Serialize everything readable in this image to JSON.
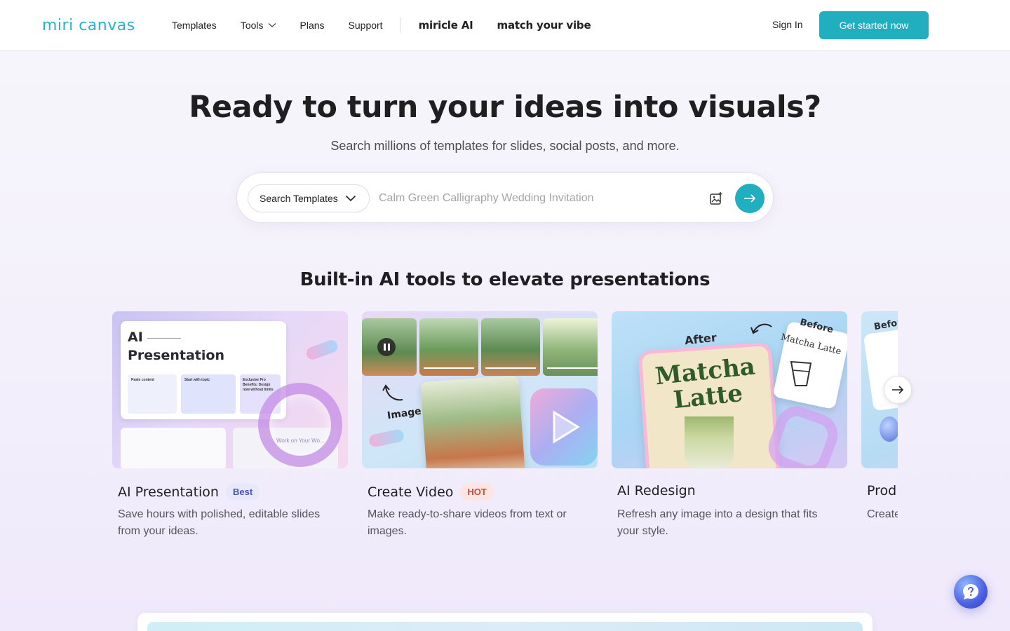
{
  "header": {
    "logo_text": "miri canvas",
    "nav": [
      {
        "label": "Templates"
      },
      {
        "label": "Tools"
      },
      {
        "label": "Plans"
      },
      {
        "label": "Support"
      }
    ],
    "brand_links": [
      "miricle AI",
      "match your vibe"
    ],
    "sign_in": "Sign In",
    "cta": "Get started now"
  },
  "hero": {
    "title": "Ready to turn your ideas into visuals?",
    "subtitle": "Search millions of templates for slides, social posts, and more.",
    "search": {
      "select_label": "Search Templates",
      "placeholder": "Calm Green Calligraphy Wedding Invitation",
      "value": ""
    }
  },
  "tools_section": {
    "title": "Built-in AI tools to elevate presentations",
    "cards": [
      {
        "title": "AI Presentation",
        "badge": "Best",
        "description": "Save hours with polished, editable slides from your ideas.",
        "img_text": {
          "heading1": "AI",
          "heading2": "Presentation",
          "col1": "Paste content",
          "col2": "Start with topic",
          "col3": "Exclusive Pro Benefits: Design now without limits",
          "overlay": "Work on Your Wo..."
        }
      },
      {
        "title": "Create Video",
        "badge": "HOT",
        "description": "Make ready-to-share videos from text or images.",
        "img_text": {
          "label": "Image"
        }
      },
      {
        "title": "AI Redesign",
        "badge": "",
        "description": "Refresh any image into a design that fits your style.",
        "img_text": {
          "after": "After",
          "before": "Before",
          "before_sub": "Matcha Latte",
          "main1": "Matcha",
          "main2": "Latte"
        }
      },
      {
        "title": "Prod",
        "badge": "",
        "description": "Create produ",
        "img_text": {
          "before": "Befor"
        }
      }
    ]
  },
  "colors": {
    "accent": "#21aebf",
    "badge_best_bg": "#e7e8fb",
    "badge_hot_bg": "#fde5e3"
  },
  "icons": [
    "chevron-down-icon",
    "image-search-icon",
    "arrow-right-icon",
    "next-arrow-icon",
    "help-icon"
  ]
}
